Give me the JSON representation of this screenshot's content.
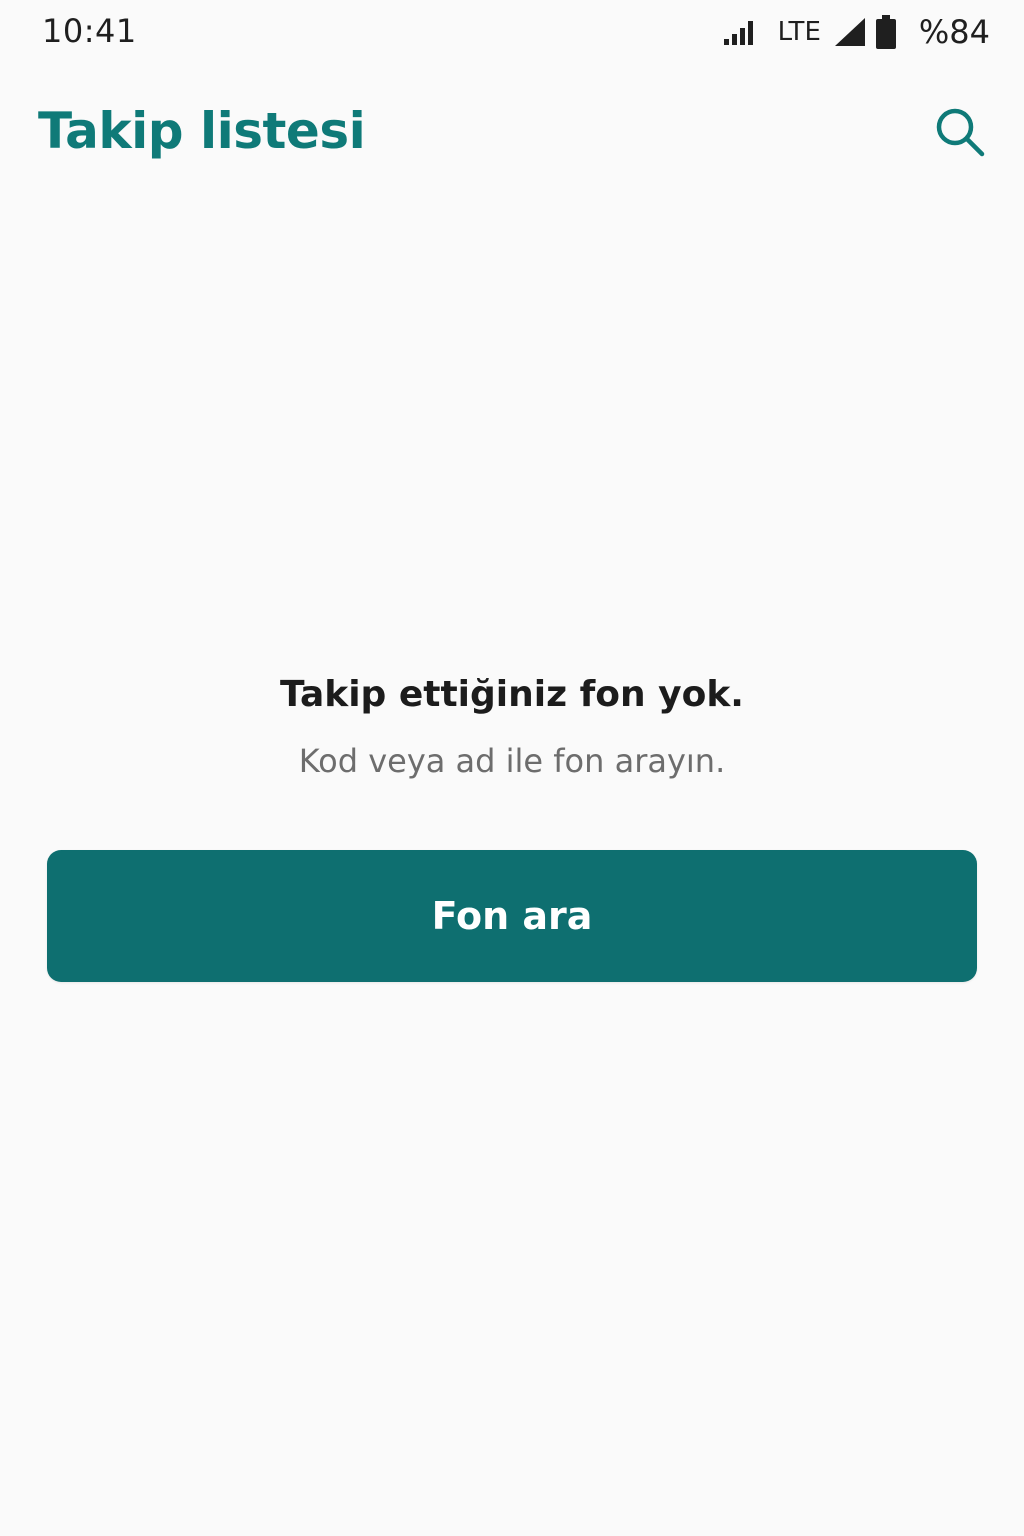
{
  "status_bar": {
    "time": "10:41",
    "network": "LTE",
    "battery": "%84",
    "icons": [
      "signal-icon",
      "cell-signal-icon",
      "battery-icon"
    ]
  },
  "app_bar": {
    "title": "Takip listesi",
    "search_icon": "search-icon"
  },
  "empty_state": {
    "title": "Takip ettiğiniz fon yok.",
    "subtitle": "Kod veya ad ile fon arayın.",
    "button_label": "Fon ara"
  },
  "colors": {
    "accent": "#0f7a78",
    "button": "#0e6f70",
    "background": "#fafafa"
  }
}
